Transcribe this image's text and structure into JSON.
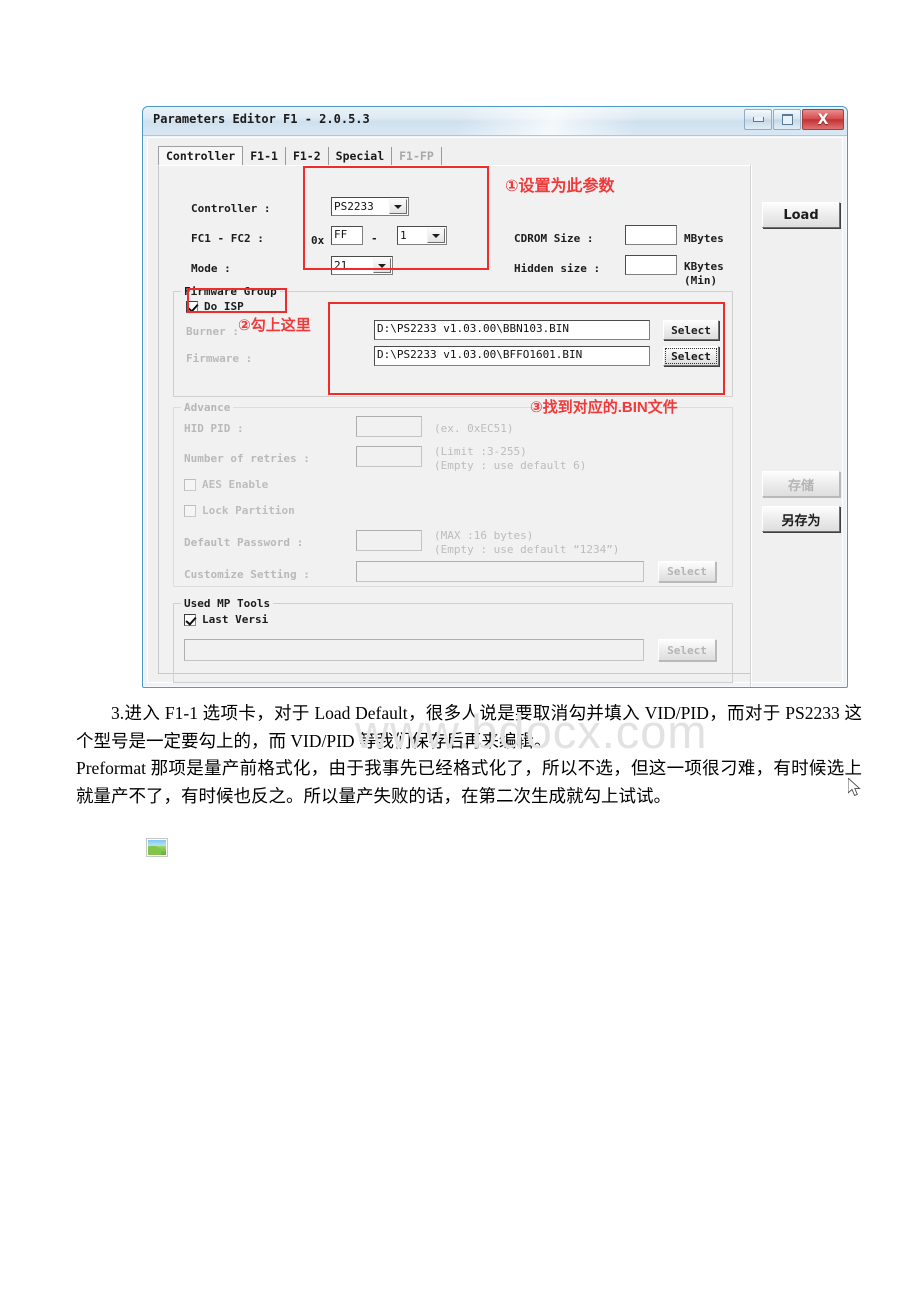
{
  "window": {
    "title": "Parameters Editor F1 - 2.0.5.3",
    "minimize_label": "Minimize",
    "maximize_label": "Maximize",
    "close_label": "X"
  },
  "tabs": [
    {
      "label": "Controller",
      "state": "active"
    },
    {
      "label": "F1-1",
      "state": "normal"
    },
    {
      "label": "F1-2",
      "state": "normal"
    },
    {
      "label": "Special",
      "state": "normal"
    },
    {
      "label": "F1-FP",
      "state": "disabled"
    }
  ],
  "controller_section": {
    "controller_label": "Controller :",
    "controller_value": "PS2233",
    "fc_label": "FC1 - FC2 :",
    "fc_prefix": "0x",
    "fc1_value": "FF",
    "fc_dash": "-",
    "fc2_value": "1",
    "mode_label": "Mode :",
    "mode_value": "21",
    "cdrom_label": "CDROM Size :",
    "cdrom_value": "",
    "cdrom_unit": "MBytes",
    "hidden_label": "Hidden size :",
    "hidden_value": "",
    "hidden_unit": "KBytes",
    "hidden_unit2": "(Min)"
  },
  "firmware_group": {
    "title": "Firmware Group",
    "do_isp_label": "Do ISP",
    "do_isp_checked": true,
    "burner_label": "Burner :",
    "burner_value": "D:\\PS2233 v1.03.00\\BBN103.BIN",
    "burner_select_label": "Select",
    "firmware_label": "Firmware :",
    "firmware_value": "D:\\PS2233 v1.03.00\\BFFO1601.BIN",
    "firmware_select_label": "Select"
  },
  "advance_group": {
    "title": "Advance",
    "hid_pid_label": "HID PID :",
    "hid_pid_value": "",
    "hid_pid_hint": "(ex. 0xEC51)",
    "retries_label": "Number of retries :",
    "retries_value": "",
    "retries_hint1": "(Limit :3-255)",
    "retries_hint2": "(Empty : use default 6)",
    "aes_label": "AES Enable",
    "aes_checked": false,
    "lock_label": "Lock Partition",
    "lock_checked": false,
    "password_label": "Default Password :",
    "password_value": "",
    "password_hint1": "(MAX :16 bytes)",
    "password_hint2": "(Empty : use default “1234”)",
    "customize_label": "Customize Setting :",
    "customize_value": "",
    "customize_select_label": "Select"
  },
  "mptools_group": {
    "title": "Used MP Tools",
    "last_version_label": "Last Versi",
    "last_version_checked": true,
    "path_value": "",
    "select_label": "Select"
  },
  "side_buttons": {
    "load_label": "Load",
    "save_label": "存储",
    "save_as_label": "另存为"
  },
  "annotations": [
    {
      "id": "1",
      "text": "①设置为此参数"
    },
    {
      "id": "2",
      "text": "②勾上这里"
    },
    {
      "id": "3",
      "text": "③找到对应的.BIN文件"
    }
  ],
  "watermark": {
    "text": "www.bdocx.com"
  },
  "article": {
    "paragraph1": "3.进入 F1-1 选项卡，对于 Load Default，很多人说是要取消勾并填入 VID/PID，而对于 PS2233 这个型号是一定要勾上的，而 VID/PID 等我们保存后再来编辑。",
    "paragraph2": "Preformat 那项是量产前格式化，由于我事先已经格式化了，所以不选，但这一项很刁难，有时候选上就量产不了，有时候也反之。所以量产失败的话，在第二次生成就勾上试试。"
  },
  "colors": {
    "annotation_red": "#f03a3a",
    "redbox_red": "#ef2b2b",
    "titlebar_blue": "#cfe0ee",
    "close_red": "#c22f2f",
    "watermark_gray": "#e2e2e2"
  }
}
